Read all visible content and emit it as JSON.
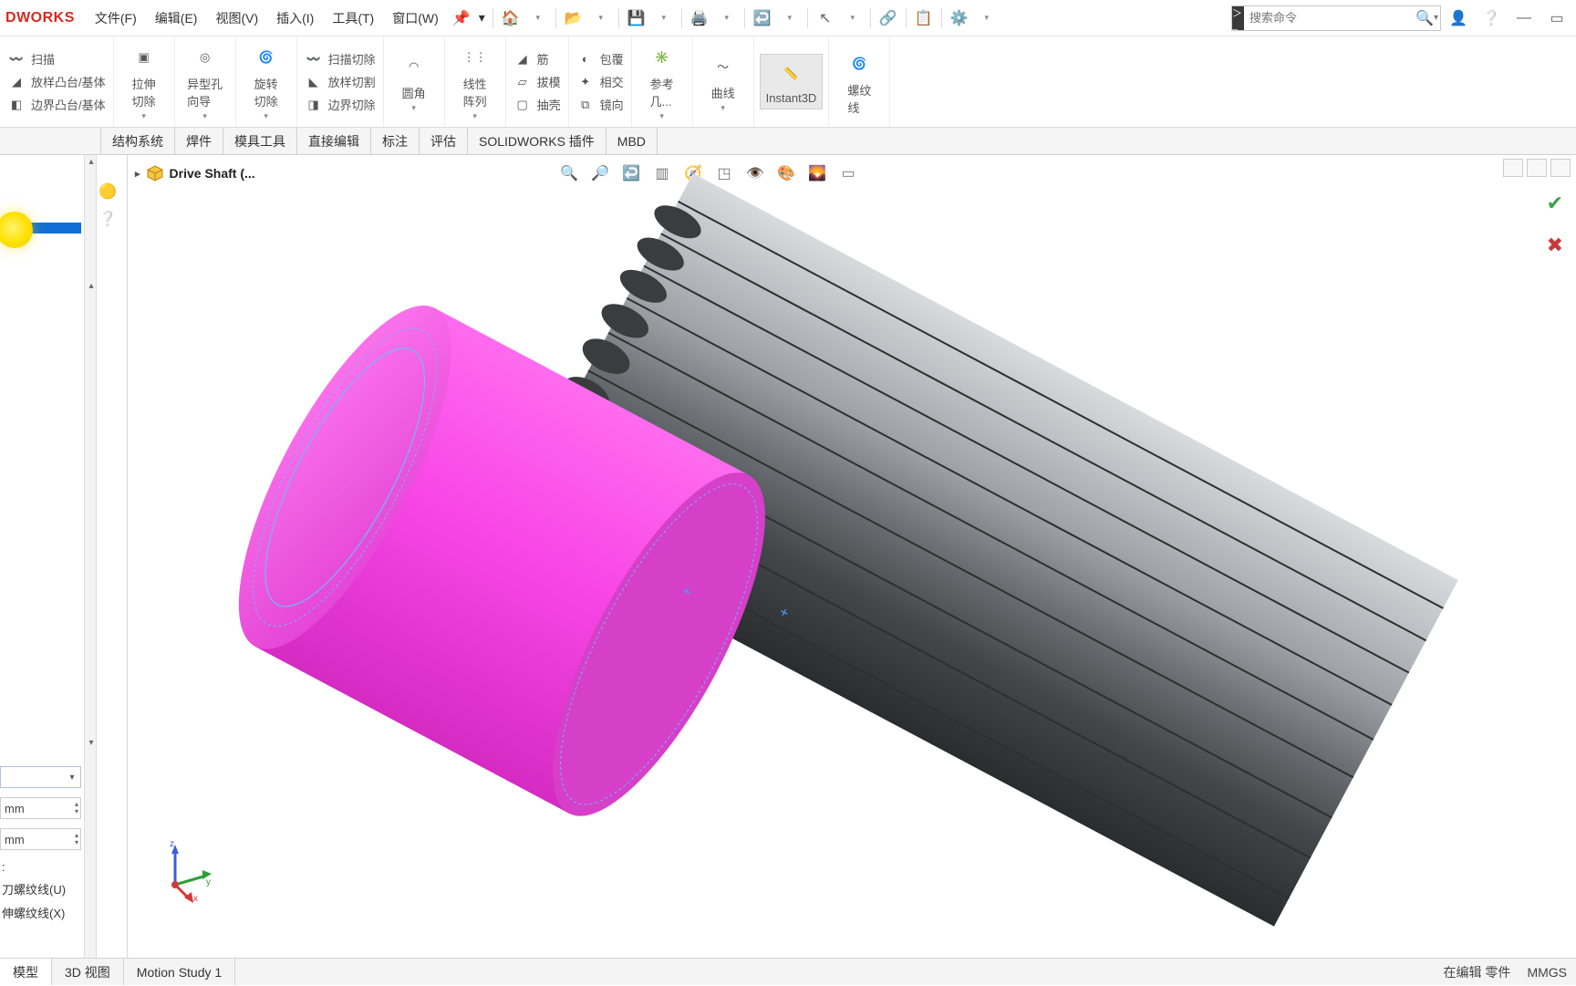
{
  "app": {
    "logo_text": "DWORKS"
  },
  "menu": {
    "file": "文件(F)",
    "edit": "编辑(E)",
    "view": "视图(V)",
    "insert": "插入(I)",
    "tools": "工具(T)",
    "window": "窗口(W)"
  },
  "search": {
    "placeholder": "搜索命令"
  },
  "ribbon": {
    "sweep": "扫描",
    "loft": "放样凸台/基体",
    "boundary": "边界凸台/基体",
    "extrude_cut": "拉伸\n切除",
    "hole_wizard": "异型孔\n向导",
    "revolve_cut": "旋转\n切除",
    "sweep_cut": "扫描切除",
    "loft_cut": "放样切割",
    "boundary_cut": "边界切除",
    "fillet": "圆角",
    "linear_pattern": "线性\n阵列",
    "rib": "筋",
    "draft": "拔模",
    "shell": "抽壳",
    "wrap": "包覆",
    "intersect": "相交",
    "mirror": "镜向",
    "ref_geom": "参考\n几...",
    "curves": "曲线",
    "instant3d": "Instant3D",
    "thread": "螺纹\n线"
  },
  "tabs": {
    "structure": "结构系统",
    "weldments": "焊件",
    "mold": "模具工具",
    "direct": "直接编辑",
    "annotate": "标注",
    "evaluate": "评估",
    "addins": "SOLIDWORKS 插件",
    "mbd": "MBD"
  },
  "tree": {
    "root": "Drive Shaft  (..."
  },
  "control_panel": {
    "unit1": "mm",
    "unit2": "mm",
    "colon": ":",
    "opt1": "刀螺纹线(U)",
    "opt2": "伸螺纹线(X)"
  },
  "bottom_tabs": {
    "model": "模型",
    "view3d": "3D 视图",
    "motion": "Motion Study 1"
  },
  "status": {
    "mode": "在编辑 零件",
    "units": "MMGS"
  },
  "triad_labels": {
    "x": "x",
    "y": "y",
    "z": "z"
  }
}
